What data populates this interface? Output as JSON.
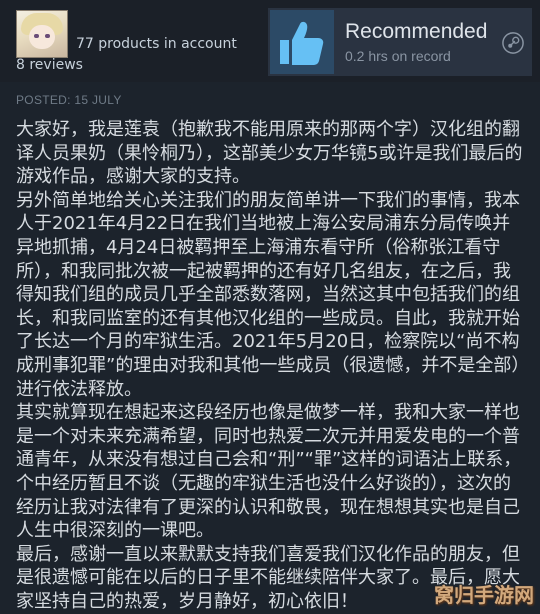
{
  "review": {
    "products_in_account": "77 products in account",
    "reviews_count": "8 reviews",
    "recommendation": "Recommended",
    "hours": "0.2 hrs on record",
    "posted": "POSTED: 15 JULY",
    "paragraphs": [
      "大家好，我是莲袁（抱歉我不能用原来的那两个字）汉化组的翻译人员果奶（果怜桐乃），这部美少女万华镜5或许是我们最后的游戏作品，感谢大家的支持。",
      "另外简单地给关心关注我们的朋友简单讲一下我们的事情，我本人于2021年4月22日在我们当地被上海公安局浦东分局传唤并异地抓捕，4月24日被羁押至上海浦东看守所（俗称张江看守所），和我同批次被一起被羁押的还有好几名组友，在之后，我得知我们组的成员几乎全部悉数落网，当然这其中包括我们的组长，和我同监室的还有其他汉化组的一些成员。自此，我就开始了长达一个月的牢狱生活。2021年5月20日，检察院以“尚不构成刑事犯罪”的理由对我和其他一些成员（很遗憾，并不是全部）进行依法释放。",
      "其实就算现在想起来这段经历也像是做梦一样，我和大家一样也是一个对未来充满希望，同时也热爱二次元并用爱发电的一个普通青年，从来没有想过自己会和“刑”“罪”这样的词语沾上联系，个中经历暂且不谈（无趣的牢狱生活也没什么好谈的），这次的经历让我对法律有了更深的认识和敬畏，现在想想其实也是自己人生中很深刻的一课吧。",
      "最后，感谢一直以来默默支持我们喜爱我们汉化作品的朋友，但是很遗憾可能在以后的日子里不能继续陪伴大家了。最后，愿大家坚持自己的热爱，岁月静好，初心依旧！"
    ]
  },
  "watermark": "窝归手游网",
  "colors": {
    "background": "#1c232c",
    "thumb_bg": "#2c4a66",
    "thumb_fg": "#66c0f4",
    "text": "#d6dbe0",
    "muted": "#6f7b87"
  },
  "icons": {
    "thumb": "thumbs-up-icon",
    "steam": "steam-icon"
  }
}
